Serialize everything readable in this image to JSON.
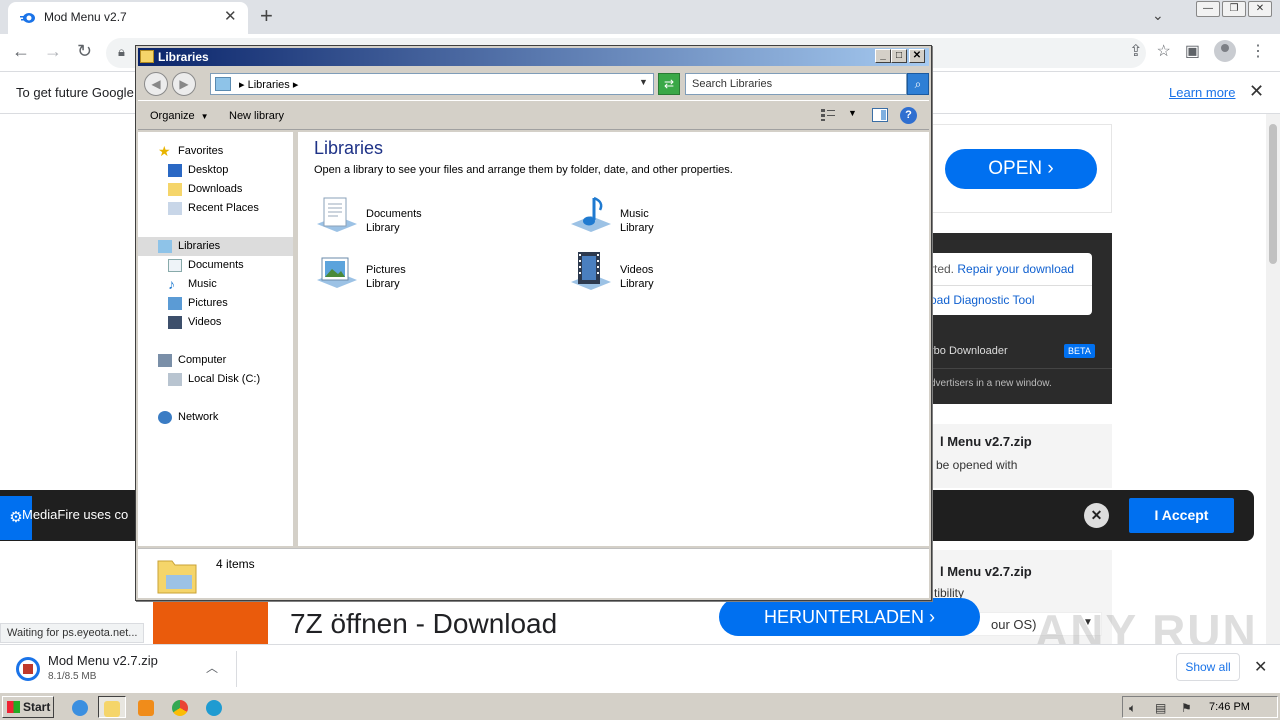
{
  "browser": {
    "tab_title": "Mod Menu v2.7",
    "tab_close": "✕",
    "new_tab": "+",
    "win_controls": [
      "—",
      "❐",
      "✕"
    ],
    "nav_icons": [
      "arrow-left-icon",
      "arrow-right-icon",
      "reload-icon"
    ],
    "infobar": {
      "text": "To get future Google",
      "learn_more": "Learn more",
      "close": "✕"
    }
  },
  "page": {
    "open_button": "OPEN",
    "repair_prefix": "rted.",
    "repair_link": "Repair your download",
    "diagnostic_link": "oad Diagnostic Tool",
    "turbo_text": "rbo Downloader",
    "beta": "BETA",
    "advertisers_text": "dvertisers in a new window.",
    "file_name_1": "l Menu v2.7.zip",
    "file_desc_1": "be opened with",
    "cookie_text": "MediaFire uses co",
    "accept_button": "I Accept",
    "file_name_2": "l Menu v2.7.zip",
    "file_desc_2": "tibility",
    "os_select": "our OS)",
    "headline_sub": "",
    "headline": "7Z öffnen - Download",
    "download_button": "HERUNTERLADEN",
    "status_text": "Waiting for ps.eyeota.net...",
    "watermark": "ANY RUN"
  },
  "download_shelf": {
    "file_name": "Mod Menu v2.7.zip",
    "progress": "8.1/8.5 MB",
    "show_all": "Show all"
  },
  "taskbar": {
    "start": "Start",
    "apps": [
      "ie-icon",
      "explorer-icon",
      "media-player-icon",
      "chrome-icon",
      "edge-icon"
    ],
    "clock": "7:46 PM"
  },
  "explorer": {
    "title": "Libraries",
    "breadcrumb": "Libraries",
    "search_placeholder": "Search Libraries",
    "toolbar": {
      "organize": "Organize",
      "new_library": "New library"
    },
    "nav_pane": {
      "favorites": "Favorites",
      "favorites_items": [
        "Desktop",
        "Downloads",
        "Recent Places"
      ],
      "libraries": "Libraries",
      "libraries_items": [
        "Documents",
        "Music",
        "Pictures",
        "Videos"
      ],
      "computer": "Computer",
      "computer_items": [
        "Local Disk (C:)"
      ],
      "network": "Network"
    },
    "heading": "Libraries",
    "description": "Open a library to see your files and arrange them by folder, date, and other properties.",
    "libraries": [
      {
        "name": "Documents",
        "type": "Library"
      },
      {
        "name": "Music",
        "type": "Library"
      },
      {
        "name": "Pictures",
        "type": "Library"
      },
      {
        "name": "Videos",
        "type": "Library"
      }
    ],
    "item_count": "4 items"
  }
}
